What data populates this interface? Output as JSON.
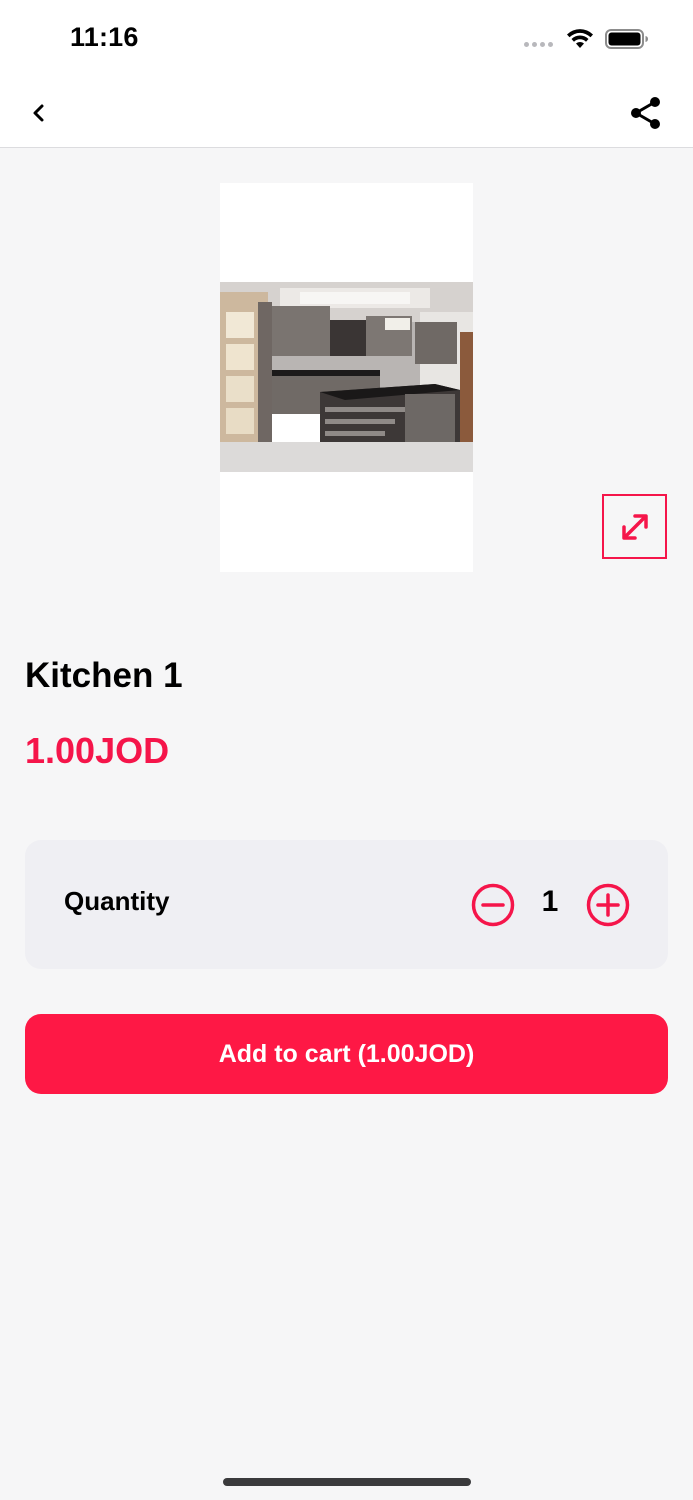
{
  "status_bar": {
    "time": "11:16",
    "icons": [
      "cellular-dots-icon",
      "wifi-icon",
      "battery-icon"
    ]
  },
  "nav": {
    "back_icon": "chevron-left-icon",
    "share_icon": "share-icon"
  },
  "product": {
    "image": "kitchen-cabinets-photo",
    "title": "Kitchen 1",
    "price": "1.00JOD"
  },
  "quantity": {
    "label": "Quantity",
    "value": "1",
    "minus_icon": "minus-circle-icon",
    "plus_icon": "plus-circle-icon"
  },
  "cart_button": {
    "label": "Add to cart (1.00JOD)"
  },
  "colors": {
    "accent": "#f5154a",
    "button": "#fe1845",
    "background": "#f6f6f7",
    "card": "#efeff3"
  }
}
